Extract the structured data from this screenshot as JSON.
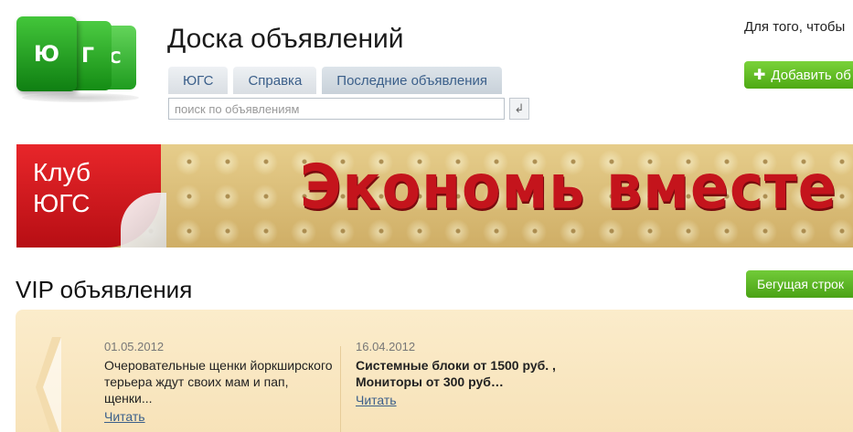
{
  "logo": {
    "letters": [
      "Ю",
      "Г",
      "С"
    ]
  },
  "site_title": "Доска объявлений",
  "tabs": [
    {
      "label": "ЮГС"
    },
    {
      "label": "Справка"
    },
    {
      "label": "Последние объявления"
    }
  ],
  "search": {
    "placeholder": "поиск по объявлениям",
    "button_glyph": "↲"
  },
  "hint_text": "Для того, чтобы",
  "add_button": {
    "label": "Добавить об",
    "icon": "plus-icon"
  },
  "banner": {
    "club_line1": "Клуб",
    "club_line2": "ЮГС",
    "slogan": "Экономь вместе с"
  },
  "vip": {
    "title": "VIP объявления",
    "ticker_button": "Бегущая строк",
    "ads": [
      {
        "date": "01.05.2012",
        "text": "Очеровательные щенки йоркширского терьера ждут своих мам и пап, щенки...",
        "read": "Читать"
      },
      {
        "date": "16.04.2012",
        "text": "Системные блоки от 1500 руб. , Мониторы от 300 руб…",
        "read": "Читать"
      }
    ]
  },
  "colors": {
    "green": "#4ea914",
    "link": "#3b5f8a",
    "banner_red": "#c4141c",
    "panel": "#fbeccb"
  }
}
